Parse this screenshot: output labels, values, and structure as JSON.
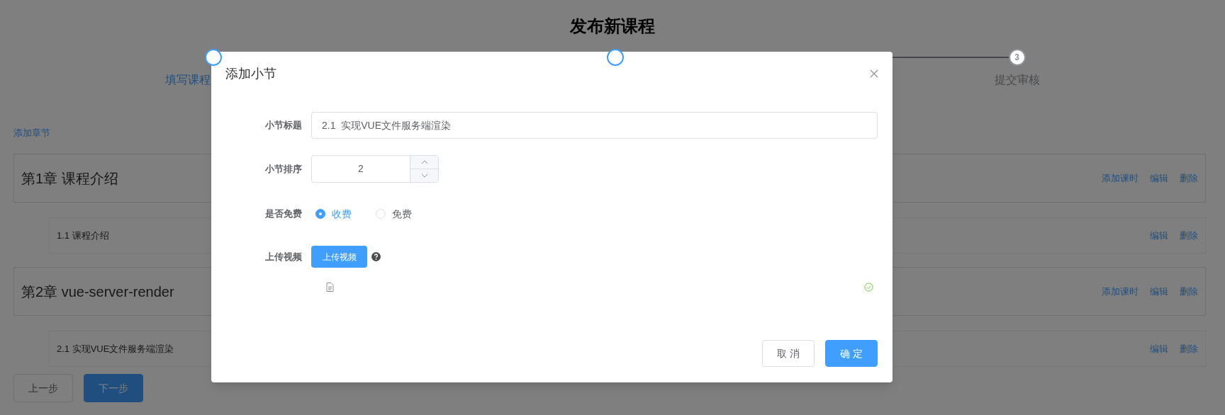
{
  "page_title": "发布新课程",
  "steps": [
    {
      "label": "填写课程",
      "active": true
    },
    {
      "active": true
    },
    {
      "number": "3",
      "label": "提交审核",
      "active": false
    }
  ],
  "add_chapter_link": "添加章节",
  "chapters": [
    {
      "title": "第1章 课程介绍",
      "actions": [
        "添加课时",
        "编辑",
        "删除"
      ],
      "sections": [
        {
          "title": "1.1 课程介绍",
          "actions": [
            "编辑",
            "删除"
          ]
        }
      ]
    },
    {
      "title": "第2章 vue-server-render",
      "actions": [
        "添加课时",
        "编辑",
        "删除"
      ],
      "sections": [
        {
          "title": "2.1 实现VUE文件服务端渲染",
          "actions": [
            "编辑",
            "删除"
          ]
        }
      ]
    }
  ],
  "page_buttons": [
    {
      "label": "上一步",
      "kind": "default"
    },
    {
      "label": "下一步",
      "kind": "primary"
    }
  ],
  "dialog": {
    "title": "添加小节",
    "fields": [
      {
        "kind": "text",
        "label": "小节标题",
        "value": "2.1  实现VUE文件服务端渲染"
      },
      {
        "kind": "number",
        "label": "小节排序",
        "value": "2"
      },
      {
        "kind": "radio",
        "label": "是否免费",
        "options": [
          {
            "label": "收费",
            "selected": true
          },
          {
            "label": "免费",
            "selected": false
          }
        ]
      },
      {
        "kind": "upload",
        "label": "上传视频",
        "button": "上传视频",
        "files": [
          {
            "success": true
          }
        ]
      }
    ],
    "buttons": [
      {
        "label": "取 消",
        "kind": "default"
      },
      {
        "label": "确 定",
        "kind": "primary"
      }
    ]
  }
}
